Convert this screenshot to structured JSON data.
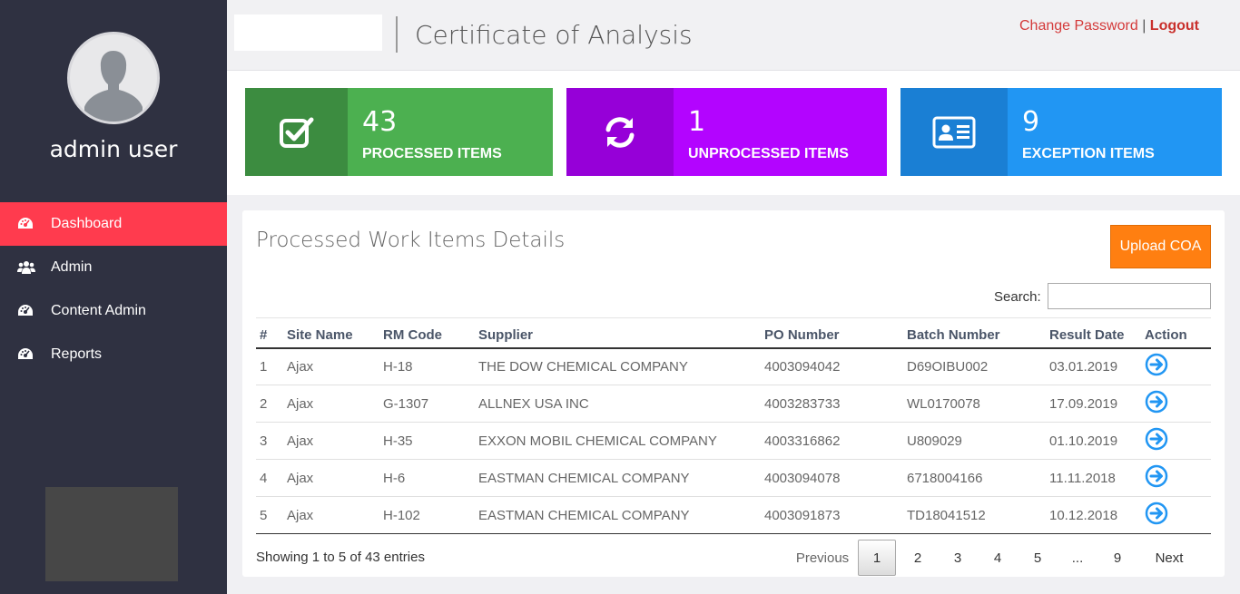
{
  "sidebar": {
    "user_name": "admin user",
    "items": [
      {
        "label": "Dashboard",
        "icon": "dashboard-icon",
        "active": true
      },
      {
        "label": "Admin",
        "icon": "users-icon"
      },
      {
        "label": "Content Admin",
        "icon": "dashboard-icon"
      },
      {
        "label": "Reports",
        "icon": "dashboard-icon"
      }
    ]
  },
  "header": {
    "title": "Certificate of Analysis",
    "change_password": "Change Password",
    "separator": "|",
    "logout": "Logout"
  },
  "cards": [
    {
      "count": "43",
      "label": "PROCESSED ITEMS",
      "icon": "checkbox-icon",
      "color": "#4cb050"
    },
    {
      "count": "1",
      "label": "UNPROCESSED ITEMS",
      "icon": "refresh-icon",
      "color": "#b304ff"
    },
    {
      "count": "9",
      "label": "EXCEPTION ITEMS",
      "icon": "id-card-icon",
      "color": "#2196f3"
    }
  ],
  "panel": {
    "title": "Processed Work Items Details",
    "upload_label": "Upload COA",
    "search_label": "Search:",
    "search_value": "",
    "columns": [
      "#",
      "Site Name",
      "RM Code",
      "Supplier",
      "PO Number",
      "Batch Number",
      "Result Date",
      "Action"
    ],
    "rows": [
      [
        "1",
        "Ajax",
        "H-18",
        "THE DOW CHEMICAL COMPANY",
        "4003094042",
        "D69OIBU002",
        "03.01.2019"
      ],
      [
        "2",
        "Ajax",
        "G-1307",
        "ALLNEX USA INC",
        "4003283733",
        "WL0170078",
        "17.09.2019"
      ],
      [
        "3",
        "Ajax",
        "H-35",
        "EXXON MOBIL CHEMICAL COMPANY",
        "4003316862",
        "U809029",
        "01.10.2019"
      ],
      [
        "4",
        "Ajax",
        "H-6",
        "EASTMAN CHEMICAL COMPANY",
        "4003094078",
        "6718004166",
        "11.11.2018"
      ],
      [
        "5",
        "Ajax",
        "H-102",
        "EASTMAN CHEMICAL COMPANY",
        "4003091873",
        "TD18041512",
        "10.12.2018"
      ]
    ],
    "showing": "Showing 1 to 5 of 43 entries",
    "pagination": {
      "previous": "Previous",
      "pages": [
        "1",
        "2",
        "3",
        "4",
        "5",
        "...",
        "9"
      ],
      "current": "1",
      "next": "Next"
    }
  }
}
